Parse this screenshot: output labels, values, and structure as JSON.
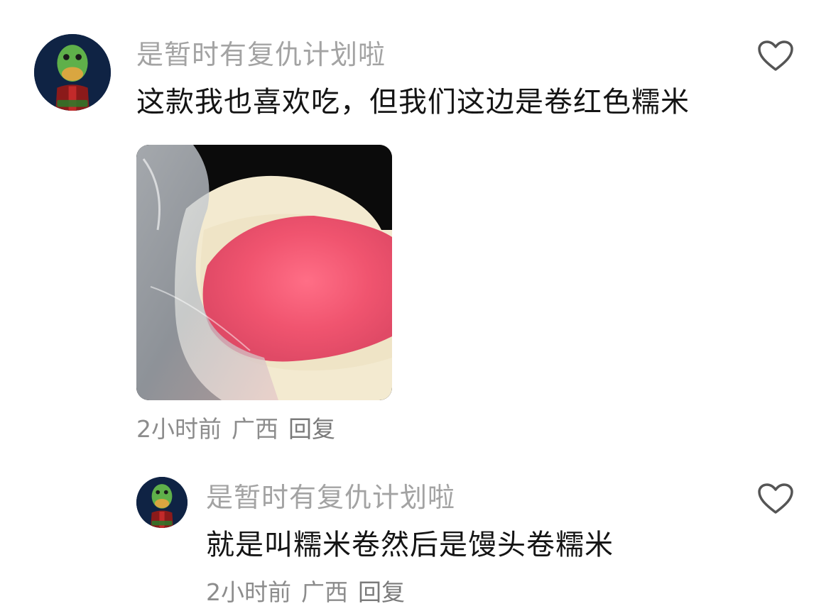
{
  "comments": [
    {
      "username": "是暂时有复仇计划啦",
      "text": "这款我也喜欢吃，但我们这边是卷红色糯米",
      "time": "2小时前",
      "location": "广西",
      "reply_label": "回复",
      "avatar_icon": "frog-mask-avatar",
      "like_icon": "heart-outline-icon",
      "has_image": true
    },
    {
      "username": "是暂时有复仇计划啦",
      "text": "就是叫糯米卷然后是馒头卷糯米",
      "time": "2小时前",
      "location": "广西",
      "reply_label": "回复",
      "avatar_icon": "frog-mask-avatar",
      "like_icon": "heart-outline-icon",
      "has_image": false
    }
  ],
  "colors": {
    "username": "#a3a3a3",
    "content": "#141414",
    "meta": "#8c8c8c",
    "icon": "#555555"
  }
}
